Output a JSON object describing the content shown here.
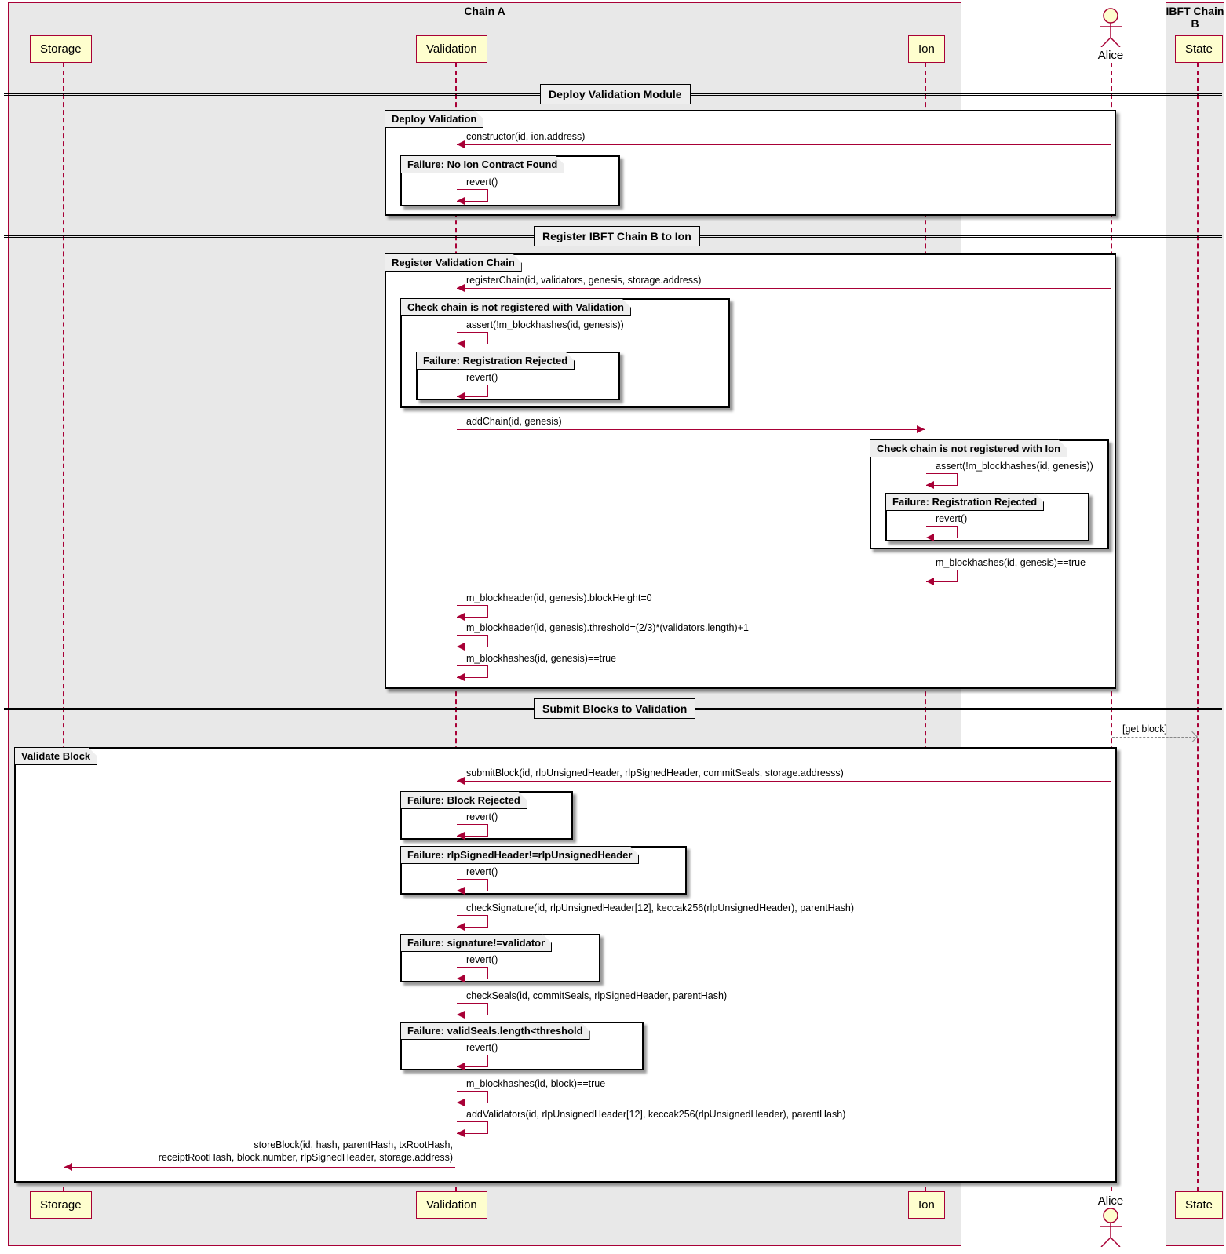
{
  "containers": {
    "chainA": "Chain A",
    "chainB": "IBFT Chain B"
  },
  "participants": {
    "storage": "Storage",
    "validation": "Validation",
    "ion": "Ion",
    "alice": "Alice",
    "state": "State"
  },
  "dividers": {
    "deploy": "Deploy Validation Module",
    "register": "Register IBFT Chain B to Ion",
    "submit": "Submit Blocks to Validation"
  },
  "groups": {
    "deployValidation": "Deploy Validation",
    "failNoIon": "Failure: No Ion Contract Found",
    "registerChain": "Register Validation Chain",
    "checkNotRegValidation": "Check chain is not registered with Validation",
    "failRegRejected1": "Failure: Registration Rejected",
    "checkNotRegIon": "Check chain is not registered with Ion",
    "failRegRejected2": "Failure: Registration Rejected",
    "validateBlock": "Validate Block",
    "failBlockRejected": "Failure: Block Rejected",
    "failRlpHeader": "Failure: rlpSignedHeader!=rlpUnsignedHeader",
    "failSignature": "Failure: signature!=validator",
    "failValidSeals": "Failure: validSeals.length<threshold"
  },
  "messages": {
    "constructor": "constructor(id, ion.address)",
    "revert": "revert()",
    "registerChain": "registerChain(id, validators, genesis, storage.address)",
    "assertBlockhashes": "assert(!m_blockhashes(id, genesis))",
    "addChain": "addChain(id, genesis)",
    "blockhashesTrue": "m_blockhashes(id, genesis)==true",
    "blockheaderHeight": "m_blockheader(id, genesis).blockHeight=0",
    "blockheaderThreshold": "m_blockheader(id, genesis).threshold=(2/3)*(validators.length)+1",
    "getBlock": "[get block]",
    "submitBlock": "submitBlock(id, rlpUnsignedHeader, rlpSignedHeader, commitSeals, storage.addresss)",
    "checkSignature": "checkSignature(id, rlpUnsignedHeader[12], keccak256(rlpUnsignedHeader), parentHash)",
    "checkSeals": "checkSeals(id, commitSeals, rlpSignedHeader, parentHash)",
    "blockhashesBlockTrue": "m_blockhashes(id, block)==true",
    "addValidators": "addValidators(id, rlpUnsignedHeader[12], keccak256(rlpUnsignedHeader), parentHash)",
    "storeBlock1": "storeBlock(id, hash, parentHash, txRootHash,",
    "storeBlock2": "receiptRootHash, block.number, rlpSignedHeader, storage.address)"
  }
}
